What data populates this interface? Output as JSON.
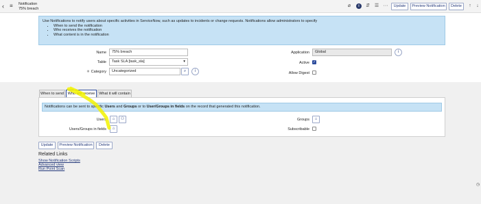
{
  "header": {
    "record_type": "Notification",
    "record_name": "75% breach",
    "buttons": {
      "update": "Update",
      "preview": "Preview Notification",
      "delete": "Delete"
    },
    "icons": [
      "back-icon",
      "menu-icon",
      "attachment-icon",
      "info-icon",
      "activity-icon",
      "settings-icon",
      "more-icon",
      "up-arrow-icon",
      "down-arrow-icon"
    ]
  },
  "info": {
    "intro": "Use Notifications to notify users about specific activities in ServiceNow, such as updates to incidents or change requests. Notifications allow administrators to specify",
    "bullets": [
      "When to send the notification",
      "Who receives the notification",
      "What content is in the notification"
    ]
  },
  "form": {
    "name_label": "Name",
    "name_value": "75% breach",
    "table_label": "Table",
    "table_value": "Task SLA [task_sla]",
    "category_label": "Category",
    "category_value": "Uncategorized",
    "application_label": "Application",
    "application_value": "Global",
    "active_label": "Active",
    "active_checked": true,
    "allow_digest_label": "Allow Digest",
    "allow_digest_checked": false
  },
  "tabs": [
    "When to send",
    "Who will receive",
    "What it will contain"
  ],
  "active_tab": "Who will receive",
  "recipients": {
    "message_pre": "Notifications can be sent to specific ",
    "message_users": "Users",
    "message_and": " and ",
    "message_groups": "Groups",
    "message_or": " or to ",
    "message_ugf": "User/Groups in fields",
    "message_post": " on the record that generated this notification.",
    "users_label": "Users",
    "groups_label": "Groups",
    "ugf_label": "Users/Groups in fields",
    "subscribable_label": "Subscribable"
  },
  "footer_buttons": {
    "update": "Update",
    "preview": "Preview Notification",
    "delete": "Delete"
  },
  "related_links": {
    "title": "Related Links",
    "links": [
      "Show Notification Scripts",
      "Advanced view",
      "Run Point Scan"
    ]
  },
  "colors": {
    "accent": "#23387a",
    "info_bg": "#c6e2f5",
    "highlight": "#f2f200"
  }
}
